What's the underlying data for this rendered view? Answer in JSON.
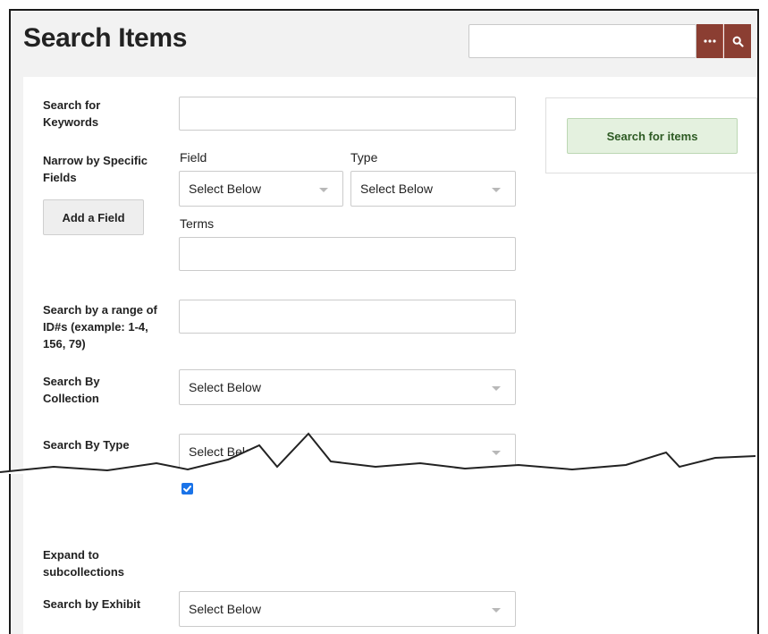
{
  "header": {
    "title": "Search Items",
    "search_value": "",
    "more_icon": "ellipsis-icon",
    "search_icon": "magnifier-icon"
  },
  "form": {
    "keywords_label": "Search for Keywords",
    "narrow_label": "Narrow by Specific Fields",
    "field_label": "Field",
    "type_label": "Type",
    "field_select": "Select Below",
    "type_select": "Select Below",
    "add_field_label": "Add a Field",
    "terms_label": "Terms",
    "range_label": "Search by a range of ID#s (example: 1-4, 156, 79)",
    "collection_label": "Search By Collection",
    "collection_select": "Select Below",
    "by_type_label": "Search By Type",
    "by_type_select": "Select Below",
    "expand_label": "Expand to subcollections",
    "expand_checked": true,
    "exhibit_label": "Search by Exhibit",
    "exhibit_select": "Select Below"
  },
  "sidebar": {
    "submit_label": "Search for items"
  },
  "colors": {
    "accent": "#8b3e32",
    "submit_bg": "#e4f1df",
    "checkbox": "#1a73e8"
  }
}
